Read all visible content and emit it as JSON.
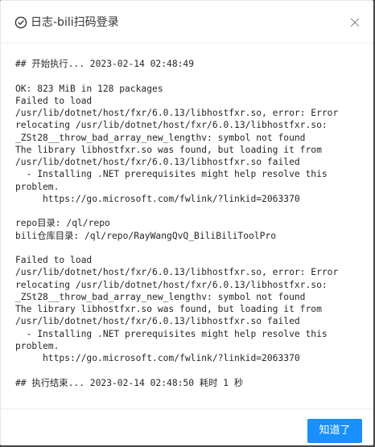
{
  "modal": {
    "title": "日志-bili扫码登录",
    "title_icon": "check-circle-icon",
    "close_icon": "close-icon"
  },
  "log": {
    "lines": [
      "## 开始执行... 2023-02-14 02:48:49",
      "",
      "OK: 823 MiB in 128 packages",
      "Failed to load",
      "/usr/lib/dotnet/host/fxr/6.0.13/libhostfxr.so, error: Error",
      "relocating /usr/lib/dotnet/host/fxr/6.0.13/libhostfxr.so:",
      "_ZSt28__throw_bad_array_new_lengthv: symbol not found",
      "The library libhostfxr.so was found, but loading it from",
      "/usr/lib/dotnet/host/fxr/6.0.13/libhostfxr.so failed",
      "  - Installing .NET prerequisites might help resolve this",
      "problem.",
      "     https://go.microsoft.com/fwlink/?linkid=2063370",
      "",
      "repo目录: /ql/repo",
      "bili仓库目录: /ql/repo/RayWangQvQ_BiliBiliToolPro",
      "",
      "Failed to load",
      "/usr/lib/dotnet/host/fxr/6.0.13/libhostfxr.so, error: Error",
      "relocating /usr/lib/dotnet/host/fxr/6.0.13/libhostfxr.so:",
      "_ZSt28__throw_bad_array_new_lengthv: symbol not found",
      "The library libhostfxr.so was found, but loading it from",
      "/usr/lib/dotnet/host/fxr/6.0.13/libhostfxr.so failed",
      "  - Installing .NET prerequisites might help resolve this",
      "problem.",
      "     https://go.microsoft.com/fwlink/?linkid=2063370",
      "",
      "## 执行结束... 2023-02-14 02:48:50 耗时 1 秒"
    ]
  },
  "footer": {
    "ok_label": "知道了"
  },
  "colors": {
    "primary": "#1890ff",
    "text": "#262626",
    "title": "#333333",
    "divider": "#f0f0f0",
    "backdrop": "#4a4a4a"
  }
}
